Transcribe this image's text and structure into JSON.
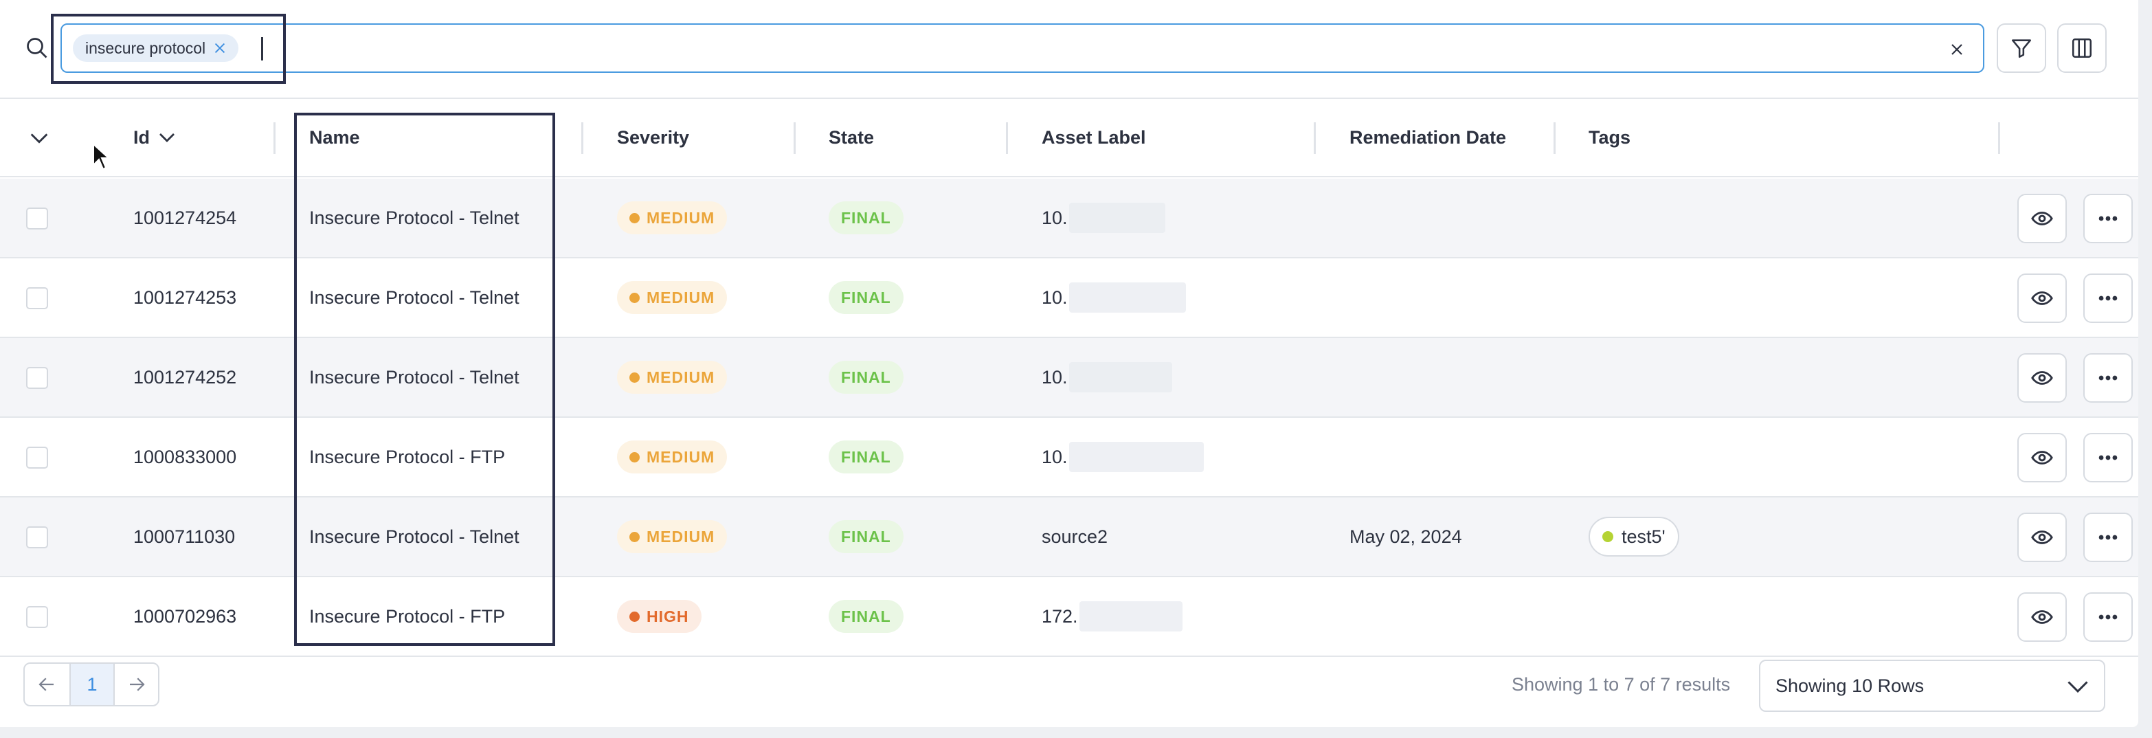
{
  "search": {
    "chip_label": "insecure protocol",
    "input_value": "",
    "placeholder": ""
  },
  "table": {
    "columns": {
      "id": "Id",
      "name": "Name",
      "severity": "Severity",
      "state": "State",
      "asset_label": "Asset Label",
      "remediation_date": "Remediation Date",
      "tags": "Tags"
    },
    "rows": [
      {
        "id": "1001274254",
        "name": "Insecure Protocol - Telnet",
        "severity": "MEDIUM",
        "state": "FINAL",
        "asset_label": "10.",
        "remediation_date": "",
        "tag": ""
      },
      {
        "id": "1001274253",
        "name": "Insecure Protocol - Telnet",
        "severity": "MEDIUM",
        "state": "FINAL",
        "asset_label": "10.",
        "remediation_date": "",
        "tag": ""
      },
      {
        "id": "1001274252",
        "name": "Insecure Protocol - Telnet",
        "severity": "MEDIUM",
        "state": "FINAL",
        "asset_label": "10.",
        "remediation_date": "",
        "tag": ""
      },
      {
        "id": "1000833000",
        "name": "Insecure Protocol - FTP",
        "severity": "MEDIUM",
        "state": "FINAL",
        "asset_label": "10.",
        "remediation_date": "",
        "tag": ""
      },
      {
        "id": "1000711030",
        "name": "Insecure Protocol - Telnet",
        "severity": "MEDIUM",
        "state": "FINAL",
        "asset_label": "source2",
        "remediation_date": "May 02, 2024",
        "tag": "test5'"
      },
      {
        "id": "1000702963",
        "name": "Insecure Protocol - FTP",
        "severity": "HIGH",
        "state": "FINAL",
        "asset_label": "172.",
        "remediation_date": "",
        "tag": ""
      }
    ]
  },
  "pagination": {
    "current_page": "1",
    "results_text": "Showing 1 to 7 of 7 results",
    "rows_select": "Showing 10 Rows"
  },
  "colors": {
    "accent": "#4a9be0",
    "medium": "#eba53a",
    "high": "#e26a2c",
    "final": "#6cc24a",
    "highlight_box": "#2b2f4b"
  }
}
